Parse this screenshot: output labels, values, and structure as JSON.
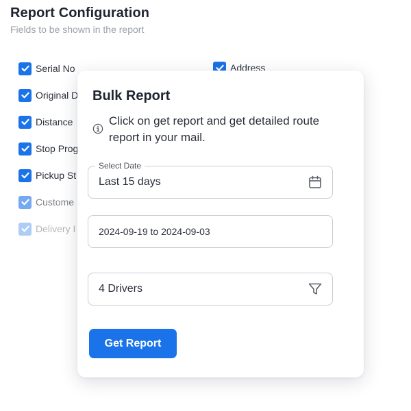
{
  "header": {
    "title": "Report Configuration",
    "subtitle": "Fields to be shown in the report"
  },
  "fields": [
    {
      "label": "Serial No",
      "checked": true
    },
    {
      "label": "Original D",
      "checked": true
    },
    {
      "label": "Distance",
      "checked": true
    },
    {
      "label": "Stop Prog",
      "checked": true
    },
    {
      "label": "Pickup St",
      "checked": true
    },
    {
      "label": "Custome",
      "checked": true
    },
    {
      "label": "Delivery I",
      "checked": true
    },
    {
      "label": "Address",
      "checked": true
    }
  ],
  "modal": {
    "title": "Bulk Report",
    "info_icon": "info-icon",
    "info_text": "Click on get report and get detailed route report in your mail.",
    "date_select": {
      "label": "Select Date",
      "value": "Last 15 days",
      "icon": "calendar-icon"
    },
    "date_range": {
      "value": "2024-09-19 to  2024-09-03"
    },
    "drivers": {
      "value": "4 Drivers",
      "icon": "filter-icon"
    },
    "submit_label": "Get Report"
  },
  "colors": {
    "accent": "#1a73e8",
    "text": "#1f2430",
    "muted": "#9aa0aa",
    "border": "#c9ccd2"
  }
}
